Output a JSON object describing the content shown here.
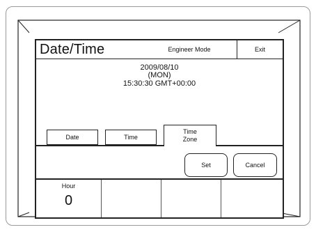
{
  "header": {
    "title": "Date/Time",
    "mode_label": "Engineer Mode",
    "exit_label": "Exit"
  },
  "current_datetime": {
    "date": "2009/08/10",
    "weekday": "(MON)",
    "time_zone": "15:30:30  GMT+00:00"
  },
  "tabs": [
    {
      "label": "Date",
      "active": false
    },
    {
      "label": "Time",
      "active": false
    },
    {
      "label_lines": [
        "Time",
        "Zone"
      ],
      "active": true
    }
  ],
  "buttons": {
    "set_label": "Set",
    "cancel_label": "Cancel"
  },
  "fields": [
    {
      "label": "Hour",
      "value": "0"
    },
    {
      "label": "",
      "value": ""
    },
    {
      "label": "",
      "value": ""
    },
    {
      "label": "",
      "value": ""
    }
  ]
}
